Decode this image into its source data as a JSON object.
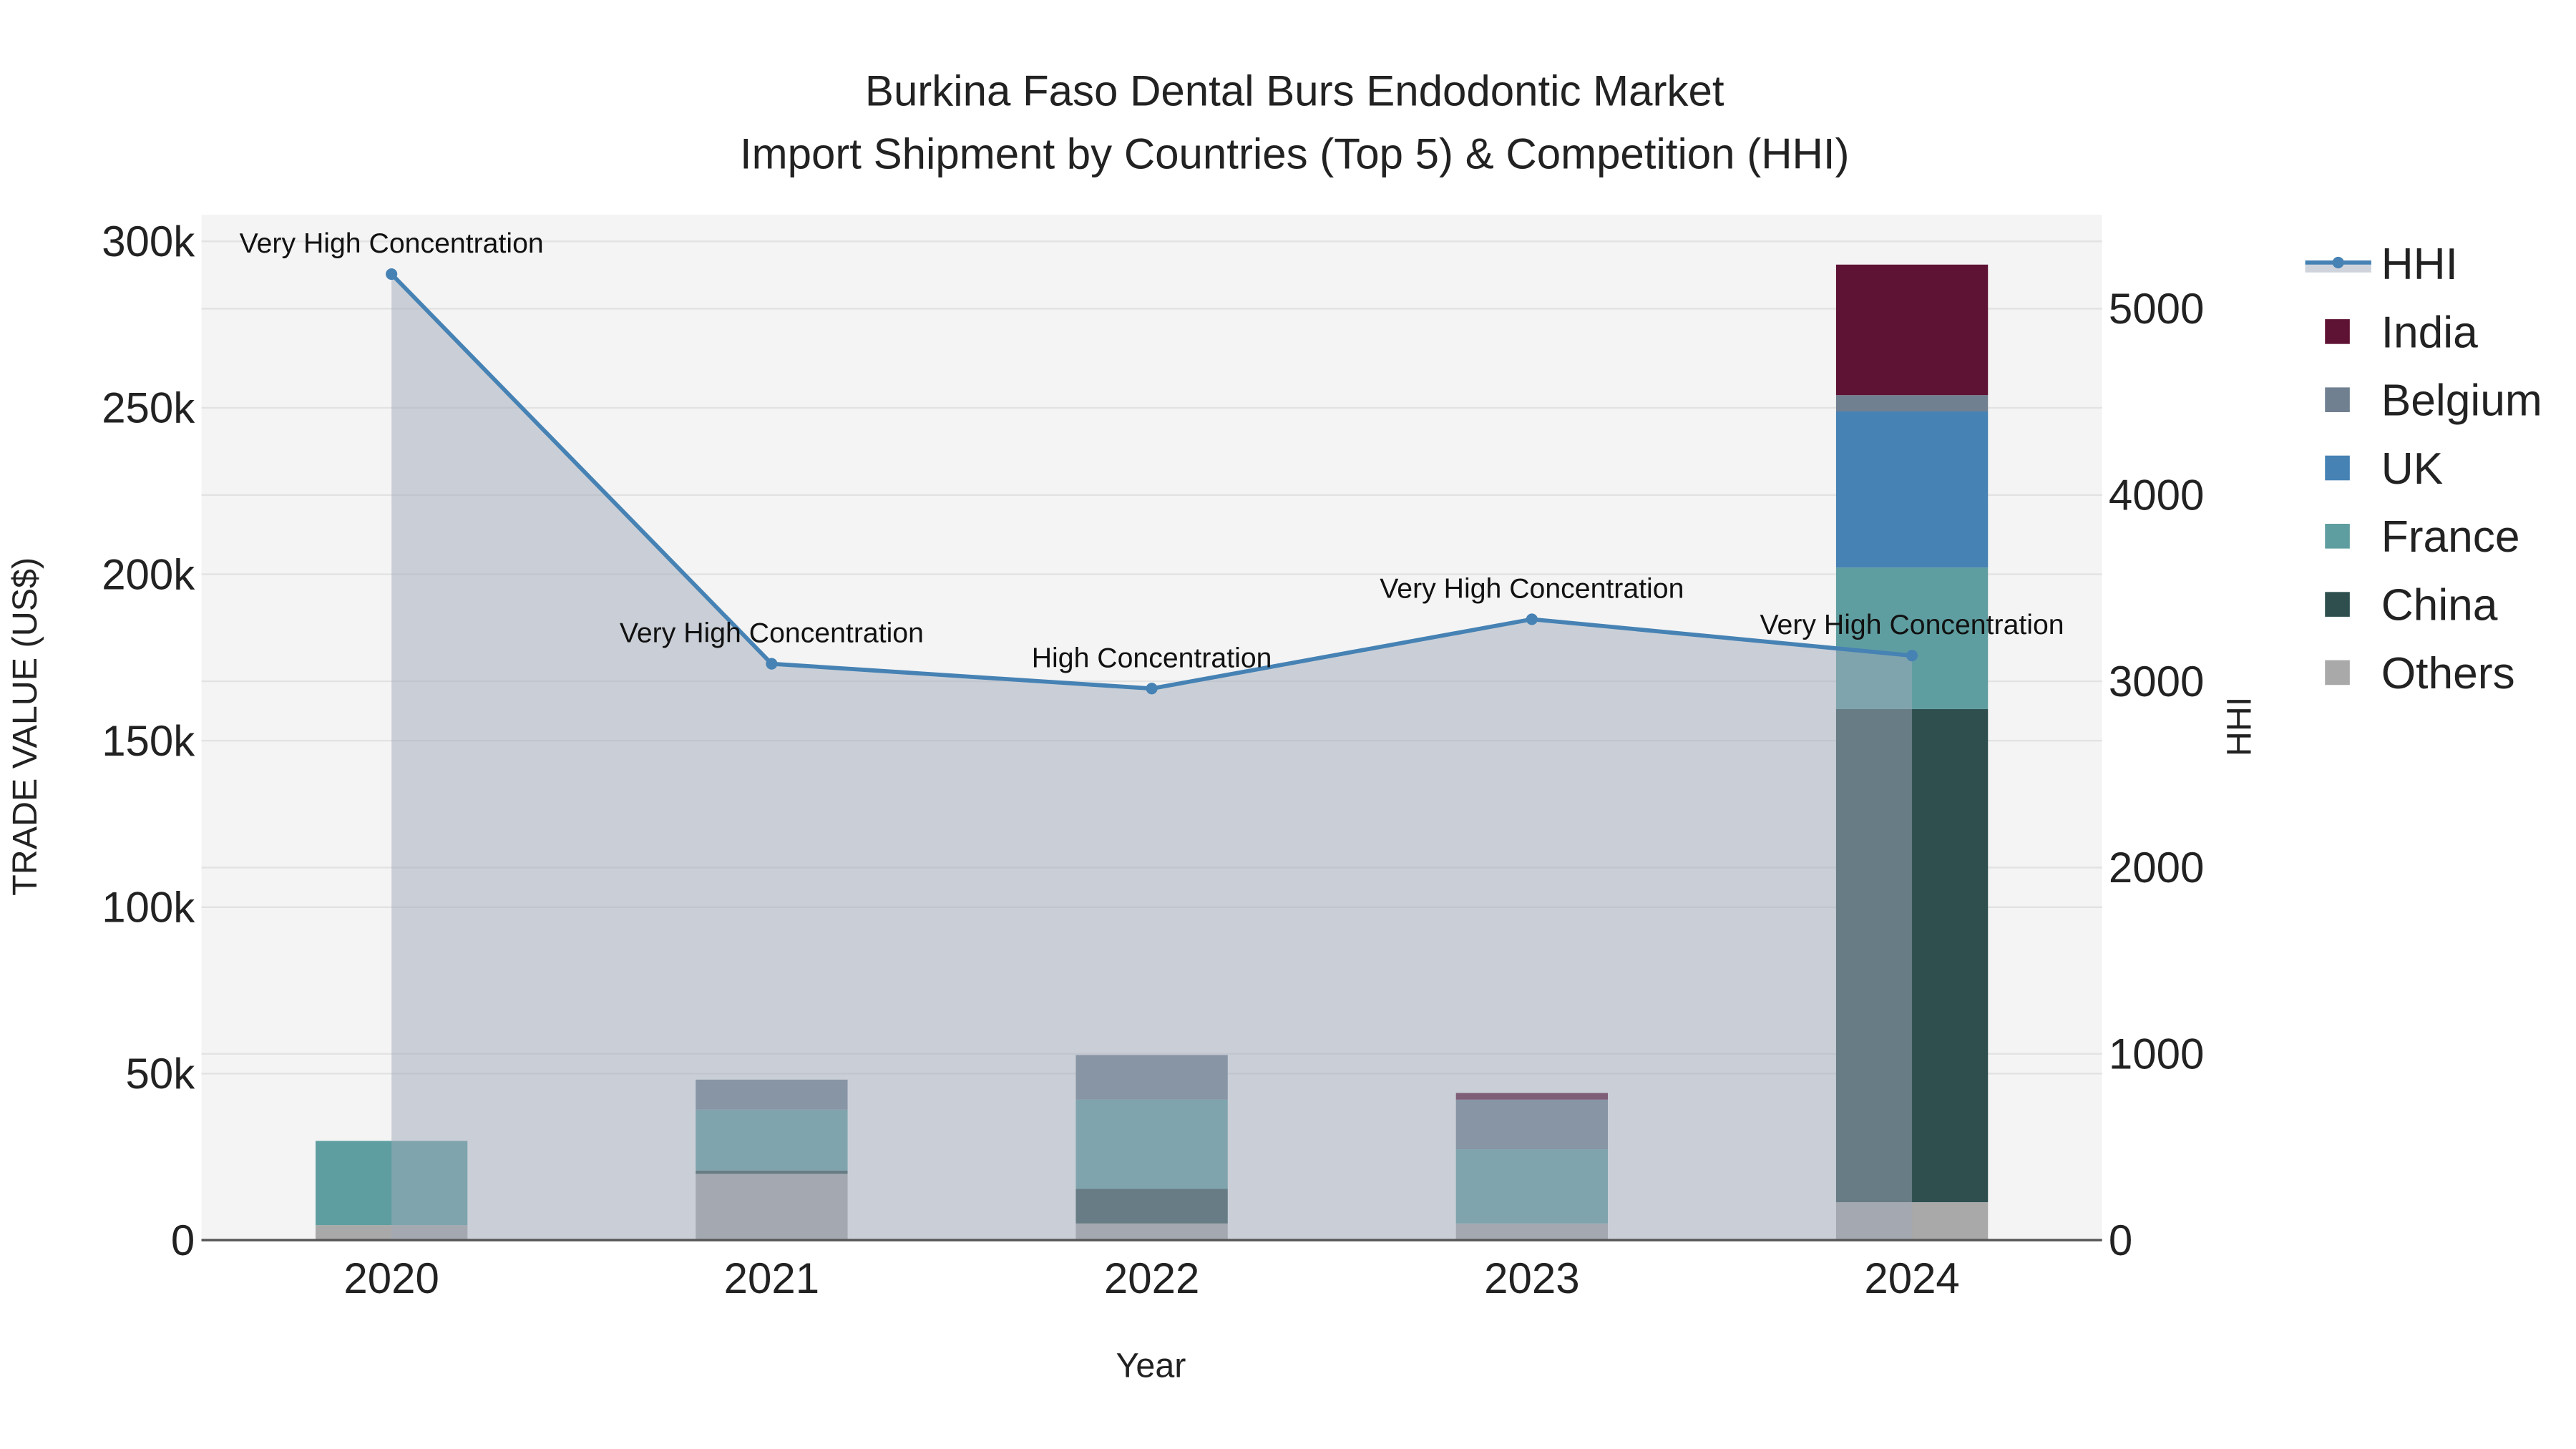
{
  "chart_data": {
    "type": "bar",
    "title_line1": "Burkina Faso Dental Burs Endodontic Market",
    "title_line2": "Import Shipment by Countries (Top 5) & Competition (HHI)",
    "xlabel": "Year",
    "ylabel": "TRADE VALUE (US$)",
    "y2label": "HHI",
    "categories": [
      "2020",
      "2021",
      "2022",
      "2023",
      "2024"
    ],
    "ylim": [
      0,
      308000
    ],
    "y2lim": [
      0,
      5505
    ],
    "yticks": [
      0,
      50000,
      100000,
      150000,
      200000,
      250000,
      300000
    ],
    "ytick_labels": [
      "0",
      "50k",
      "100k",
      "150k",
      "200k",
      "250k",
      "300k"
    ],
    "y2ticks": [
      0,
      1000,
      2000,
      3000,
      4000,
      5000
    ],
    "y2tick_labels": [
      "0",
      "1000",
      "2000",
      "3000",
      "4000",
      "5000"
    ],
    "grid": true,
    "stacked": true,
    "legend_position": "right",
    "series": [
      {
        "name": "Others",
        "color": "#a9a9a9",
        "values": [
          4500,
          19900,
          5000,
          5000,
          11400
        ]
      },
      {
        "name": "China",
        "color": "#2f4f4f",
        "values": [
          0,
          1000,
          10400,
          0,
          148100
        ]
      },
      {
        "name": "France",
        "color": "#5f9ea0",
        "values": [
          25300,
          18300,
          26800,
          22300,
          42500
        ]
      },
      {
        "name": "UK",
        "color": "#4682b4",
        "values": [
          0,
          0,
          0,
          0,
          46900
        ]
      },
      {
        "name": "Belgium",
        "color": "#708090",
        "values": [
          0,
          9000,
          13400,
          14900,
          4900
        ]
      },
      {
        "name": "India",
        "color": "#5f1334",
        "values": [
          0,
          0,
          0,
          2000,
          39200
        ]
      }
    ],
    "hhi": {
      "name": "HHI",
      "color": "#4682b4",
      "values": [
        5186,
        3094,
        2961,
        3333,
        3138
      ],
      "annotations": [
        "Very High Concentration",
        "Very High Concentration",
        "High Concentration",
        "Very High Concentration",
        "Very High Concentration"
      ]
    },
    "legend": [
      "HHI",
      "India",
      "Belgium",
      "UK",
      "France",
      "China",
      "Others"
    ]
  }
}
